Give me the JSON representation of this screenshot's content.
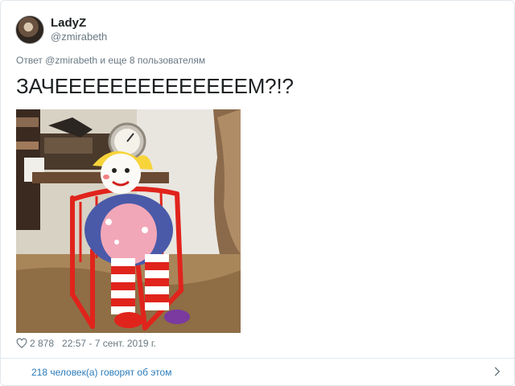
{
  "author": {
    "display_name": "LadyZ",
    "handle": "@zmirabeth",
    "avatar_icon": "avatar-photo"
  },
  "tweet": {
    "reply_to": "Ответ @zmirabeth и еще 8 пользователям",
    "text": "ЗАЧЕЕЕЕЕЕЕЕЕЕЕЕЕЕМ?!?",
    "media_description_icon": "photo"
  },
  "meta": {
    "heart_icon": "heart-icon",
    "likes": "2 878",
    "timestamp": "22:57 - 7 сент. 2019 г."
  },
  "footer": {
    "talking_label": "218 человек(а) говорят об этом",
    "chevron_icon": "chevron-right-icon"
  },
  "colors": {
    "link": "#2b7bb9",
    "muted": "#697882",
    "border": "#e1e8ed"
  }
}
